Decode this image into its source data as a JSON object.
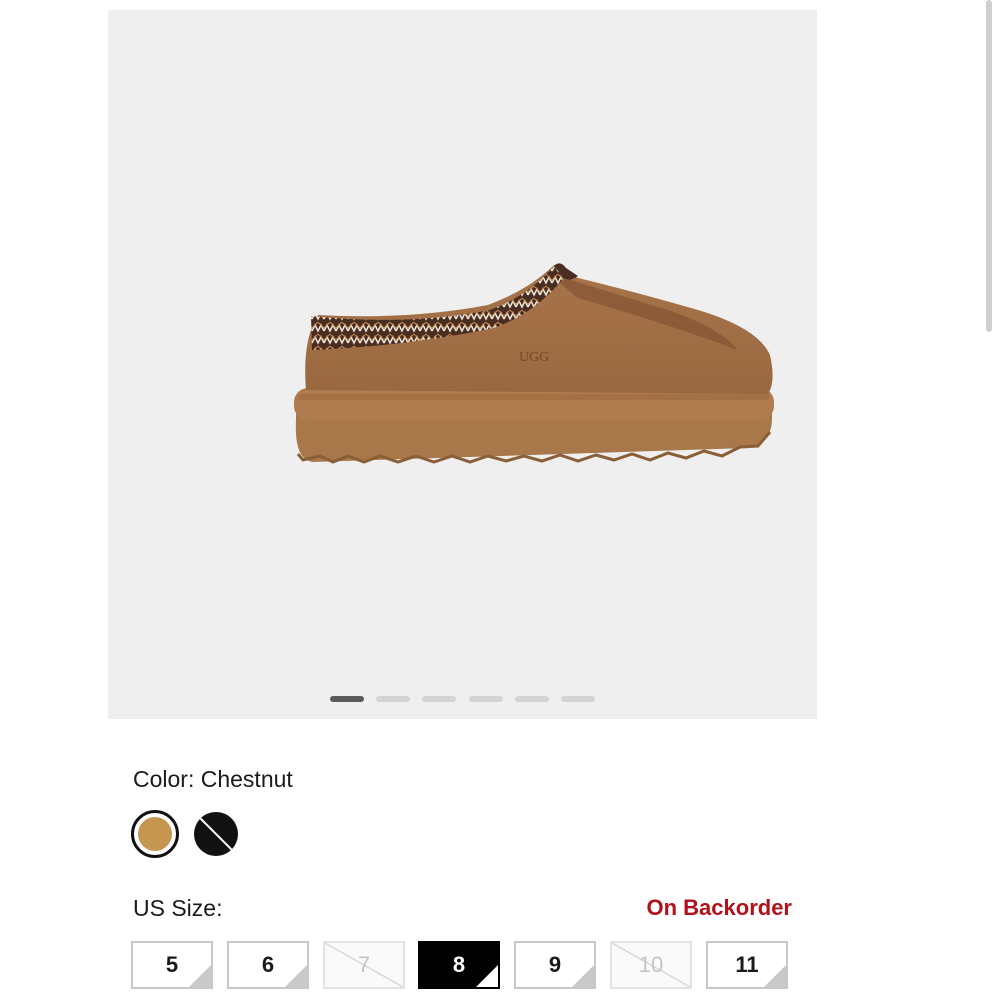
{
  "gallery": {
    "image_alt": "Chestnut suede slipper with braided collar",
    "logo_text": "UGG",
    "slide_count": 6,
    "active_slide": 1
  },
  "color": {
    "label": "Color: Chestnut",
    "swatches": [
      {
        "name": "Chestnut",
        "hex": "#c4964f",
        "selected": true,
        "available": true
      },
      {
        "name": "Black",
        "hex": "#111111",
        "selected": false,
        "available": false
      }
    ]
  },
  "size": {
    "label": "US Size:",
    "status": "On Backorder",
    "status_color": "#b1121a",
    "options": [
      {
        "label": "5",
        "available": true,
        "selected": false
      },
      {
        "label": "6",
        "available": true,
        "selected": false
      },
      {
        "label": "7",
        "available": false,
        "selected": false
      },
      {
        "label": "8",
        "available": true,
        "selected": true
      },
      {
        "label": "9",
        "available": true,
        "selected": false
      },
      {
        "label": "10",
        "available": false,
        "selected": false
      },
      {
        "label": "11",
        "available": true,
        "selected": false
      }
    ]
  }
}
